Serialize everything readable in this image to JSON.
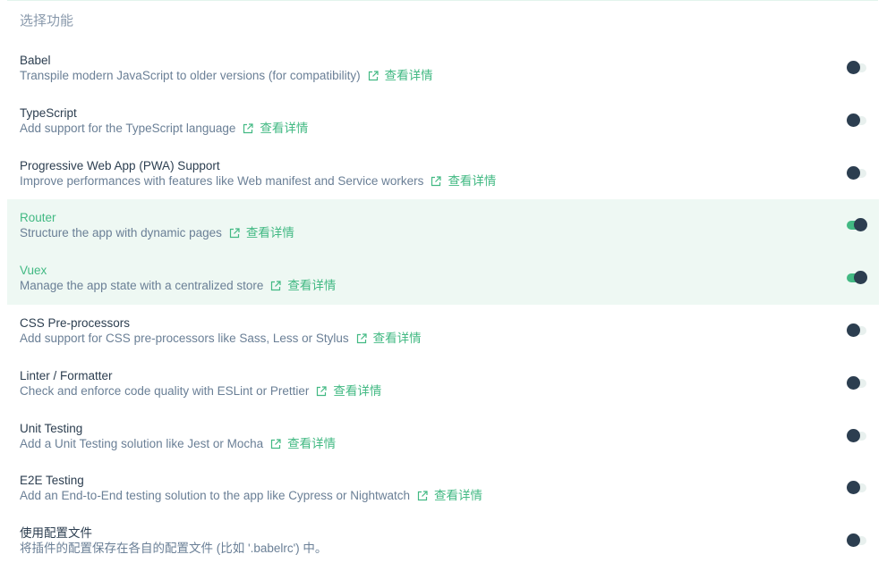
{
  "section_title": "选择功能",
  "colors": {
    "accent": "#42b983",
    "text_dark": "#2c3e50",
    "text_muted": "#6a7f96",
    "selected_bg": "#eef8f3"
  },
  "features": [
    {
      "name": "Babel",
      "description": "Transpile modern JavaScript to older versions (for compatibility)",
      "link_label": "查看详情",
      "enabled": false
    },
    {
      "name": "TypeScript",
      "description": "Add support for the TypeScript language",
      "link_label": "查看详情",
      "enabled": false
    },
    {
      "name": "Progressive Web App (PWA) Support",
      "description": "Improve performances with features like Web manifest and Service workers",
      "link_label": "查看详情",
      "enabled": false
    },
    {
      "name": "Router",
      "description": "Structure the app with dynamic pages",
      "link_label": "查看详情",
      "enabled": true
    },
    {
      "name": "Vuex",
      "description": "Manage the app state with a centralized store",
      "link_label": "查看详情",
      "enabled": true
    },
    {
      "name": "CSS Pre-processors",
      "description": "Add support for CSS pre-processors like Sass, Less or Stylus",
      "link_label": "查看详情",
      "enabled": false
    },
    {
      "name": "Linter / Formatter",
      "description": "Check and enforce code quality with ESLint or Prettier",
      "link_label": "查看详情",
      "enabled": false
    },
    {
      "name": "Unit Testing",
      "description": "Add a Unit Testing solution like Jest or Mocha",
      "link_label": "查看详情",
      "enabled": false
    },
    {
      "name": "E2E Testing",
      "description": "Add an End-to-End testing solution to the app like Cypress or Nightwatch",
      "link_label": "查看详情",
      "enabled": false
    },
    {
      "name": "使用配置文件",
      "description": "将插件的配置保存在各自的配置文件 (比如 '.babelrc') 中。",
      "link_label": "",
      "enabled": false
    }
  ]
}
